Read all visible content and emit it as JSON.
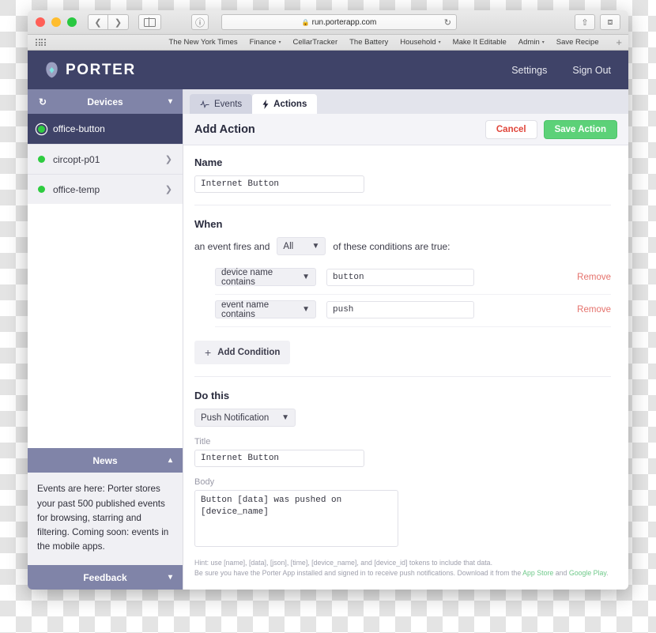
{
  "browser": {
    "url": "run.porterapp.com",
    "back_icon": "chevron-left-icon",
    "forward_icon": "chevron-right-icon",
    "sidebar_icon": "sidebar-toggle-icon",
    "reader_icon": "reader-view-icon",
    "lock_icon": "lock-icon",
    "reload_icon": "reload-icon",
    "share_icon": "share-icon",
    "tabs_icon": "show-tabs-icon",
    "new_tab_label": "+",
    "bookmarks": [
      {
        "label": "The New York Times",
        "has_caret": false
      },
      {
        "label": "Finance",
        "has_caret": true
      },
      {
        "label": "CellarTracker",
        "has_caret": false
      },
      {
        "label": "The Battery",
        "has_caret": false
      },
      {
        "label": "Household",
        "has_caret": true
      },
      {
        "label": "Make It Editable",
        "has_caret": false
      },
      {
        "label": "Admin",
        "has_caret": true
      },
      {
        "label": "Save Recipe",
        "has_caret": false
      }
    ]
  },
  "header": {
    "brand": "PORTER",
    "links": [
      "Settings",
      "Sign Out"
    ],
    "bg": "#3f4368",
    "logo_accent": "#7fe3e0"
  },
  "sidebar": {
    "devices_panel": {
      "title": "Devices",
      "refresh_icon": "refresh-icon",
      "chevron_icon": "chevron-down-icon"
    },
    "devices": [
      {
        "name": "office-button",
        "selected": true,
        "status": "online"
      },
      {
        "name": "circopt-p01",
        "selected": false,
        "status": "online"
      },
      {
        "name": "office-temp",
        "selected": false,
        "status": "online"
      }
    ],
    "news_panel": {
      "title": "News",
      "chevron_icon": "chevron-up-icon",
      "body": "Events are here: Porter stores your past 500 published events for browsing, starring and filtering. Coming soon: events in the mobile apps."
    },
    "feedback_panel": {
      "title": "Feedback",
      "chevron_icon": "chevron-down-icon"
    }
  },
  "main": {
    "tabs": [
      {
        "label": "Events",
        "icon": "pulse-icon",
        "active": false
      },
      {
        "label": "Actions",
        "icon": "lightning-icon",
        "active": true
      }
    ],
    "content_title": "Add Action",
    "cancel_label": "Cancel",
    "save_label": "Save Action",
    "accent_save": "#5cd178",
    "accent_cancel": "#e0453a",
    "name": {
      "label": "Name",
      "value": "Internet Button"
    },
    "when": {
      "label": "When",
      "prefix": "an event fires and",
      "match_value": "All",
      "suffix": "of these conditions are true:",
      "conditions": [
        {
          "field": "device name contains",
          "value": "button",
          "remove_label": "Remove"
        },
        {
          "field": "event name contains",
          "value": "push",
          "remove_label": "Remove"
        }
      ],
      "add_condition_label": "Add Condition",
      "add_icon": "plus-icon"
    },
    "do_this": {
      "label": "Do this",
      "action_type": "Push Notification",
      "title_label": "Title",
      "title_value": "Internet Button",
      "body_label": "Body",
      "body_value": "Button [data] was pushed on [device_name]"
    },
    "hint": {
      "line1": "Hint: use [name], [data], [json], [time], [device_name], and [device_id] tokens to include that data.",
      "line2_pre": "Be sure you have the Porter App installed and signed in to receive push notifications. Download it from the ",
      "link1": "App Store",
      "line2_mid": " and ",
      "link2": "Google Play",
      "line2_end": "."
    }
  }
}
